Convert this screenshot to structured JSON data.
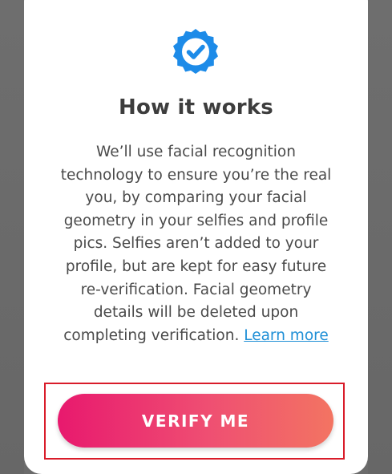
{
  "modal": {
    "icon": "verified-badge-icon",
    "title": "How it works",
    "body_text": "We’ll use facial recognition technology to ensure you’re the real you, by comparing your facial geometry in your selfies and profile pics. Selfies aren’t added to your profile, but are kept for easy future re-verification. Facial geometry details will be deleted upon completing verification.",
    "learn_more_label": "Learn more",
    "verify_button_label": "VERIFY ME"
  },
  "colors": {
    "badge_blue": "#1d8be8",
    "link_blue": "#1f8fd6",
    "button_gradient_start": "#e8196e",
    "button_gradient_end": "#f37462",
    "highlight_red": "#d91c2a",
    "overlay_gray": "#6b6b6b"
  }
}
